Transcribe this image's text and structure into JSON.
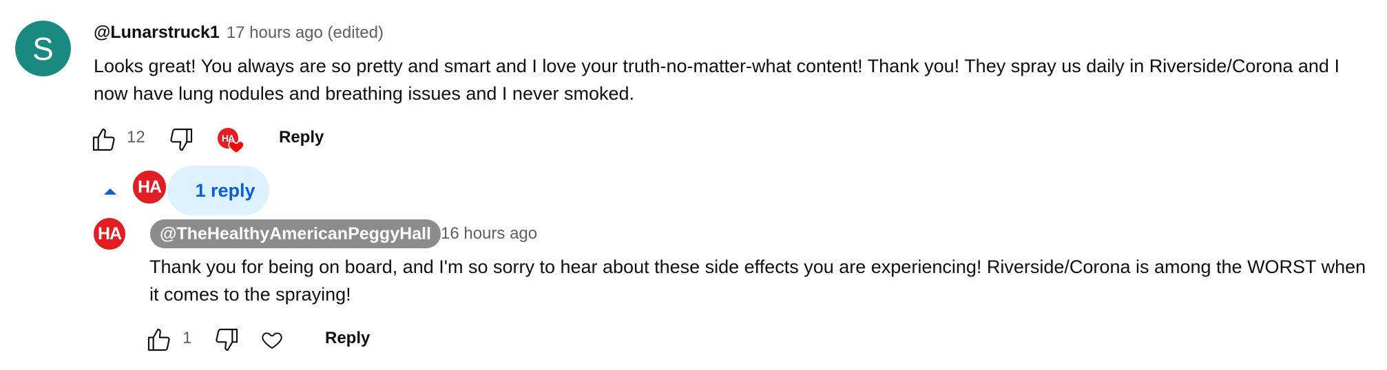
{
  "comment": {
    "avatar_letter": "S",
    "avatar_color": "#1a8a80",
    "author": "@Lunarstruck1",
    "timestamp": "17 hours ago (edited)",
    "text": "Looks great!  You always are so pretty and smart and I love your truth-no-matter-what content!  Thank you!  They spray us daily in Riverside/Corona and I now have lung nodules and breathing issues and I never smoked.",
    "like_count": "12",
    "reply_label": "Reply",
    "creator_heart_avatar": "HA"
  },
  "replies_toggle": {
    "creator_avatar": "HA",
    "label": "1 reply",
    "expanded": true
  },
  "reply": {
    "avatar_text": "HA",
    "avatar_color": "#e01e24",
    "author": "@TheHealthyAmericanPeggyHall",
    "timestamp": "16 hours ago",
    "text": "Thank you for being on board, and I'm so sorry to hear about these side effects you are experiencing! Riverside/Corona is among the WORST when it comes to the spraying!",
    "like_count": "1",
    "reply_label": "Reply"
  },
  "icons": {
    "like": "thumbs-up-icon",
    "dislike": "thumbs-down-icon",
    "heart": "heart-icon",
    "collapse": "caret-up-icon"
  },
  "colors": {
    "accent_blue": "#065fd4",
    "pill_background": "#def1ff",
    "heart_red": "#ff0000",
    "creator_badge_bg": "#8c8c8c"
  }
}
